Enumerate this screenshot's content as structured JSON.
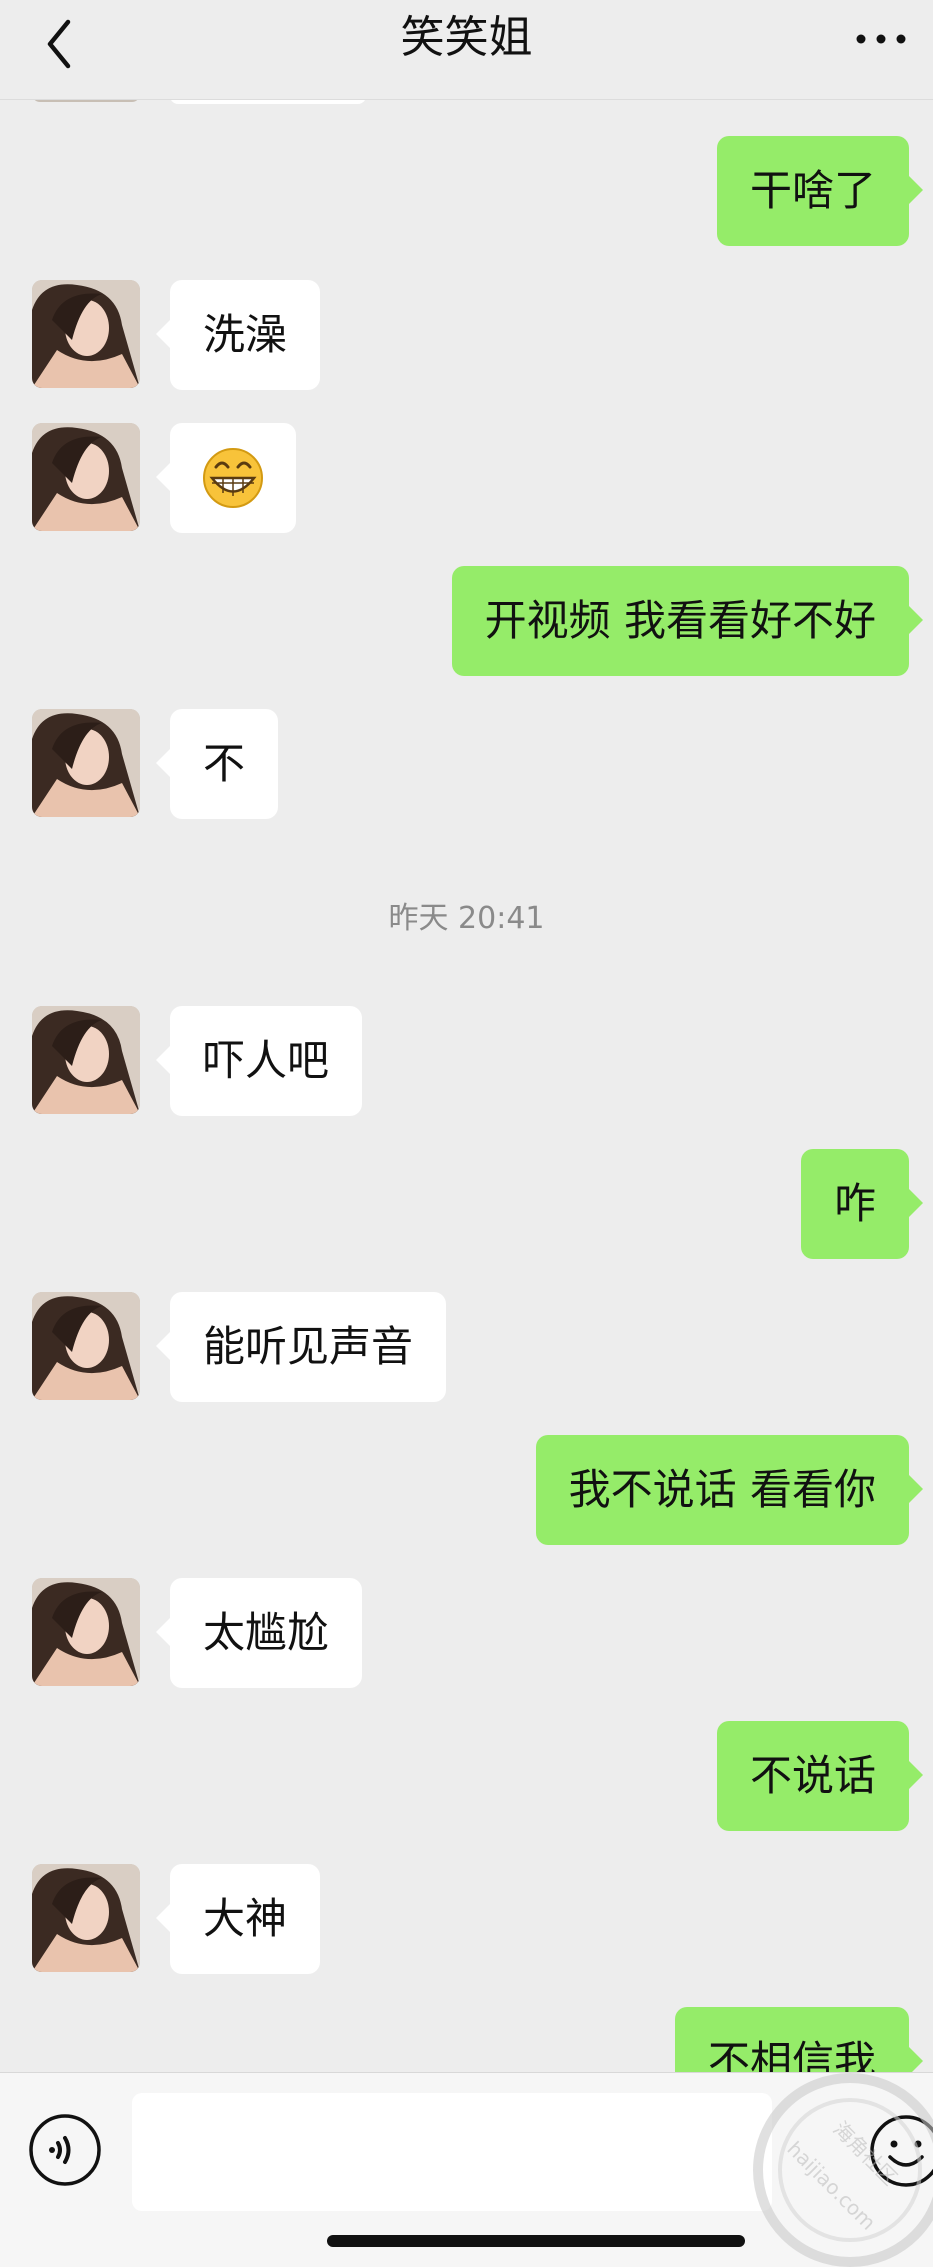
{
  "header": {
    "title": "笑笑姐",
    "back_icon": "chevron-left-icon",
    "more_icon": "more-dots-icon"
  },
  "messages": [
    {
      "side": "out",
      "text": "干啥了"
    },
    {
      "side": "in",
      "text": "洗澡"
    },
    {
      "side": "in",
      "emoji": "grinning-face",
      "text": ""
    },
    {
      "side": "out",
      "text": "开视频 我看看好不好"
    },
    {
      "side": "in",
      "text": "不"
    },
    {
      "timestamp": "昨天 20:41"
    },
    {
      "side": "in",
      "text": "吓人吧"
    },
    {
      "side": "out",
      "text": "咋"
    },
    {
      "side": "in",
      "text": "能听见声音"
    },
    {
      "side": "out",
      "text": "我不说话 看看你"
    },
    {
      "side": "in",
      "text": "太尴尬"
    },
    {
      "side": "out",
      "text": "不说话"
    },
    {
      "side": "in",
      "text": "大神"
    },
    {
      "side": "out",
      "text": "不相信我"
    }
  ],
  "input_bar": {
    "voice_icon": "voice-icon",
    "input_value": "",
    "emoji_icon": "emoji-icon"
  },
  "watermark": {
    "text_top": "海角社区",
    "text_bottom": "haijiao.com"
  },
  "colors": {
    "background": "#ededed",
    "incoming_bubble": "#ffffff",
    "outgoing_bubble": "#95ec69",
    "timestamp_text": "#8a8a8a"
  }
}
